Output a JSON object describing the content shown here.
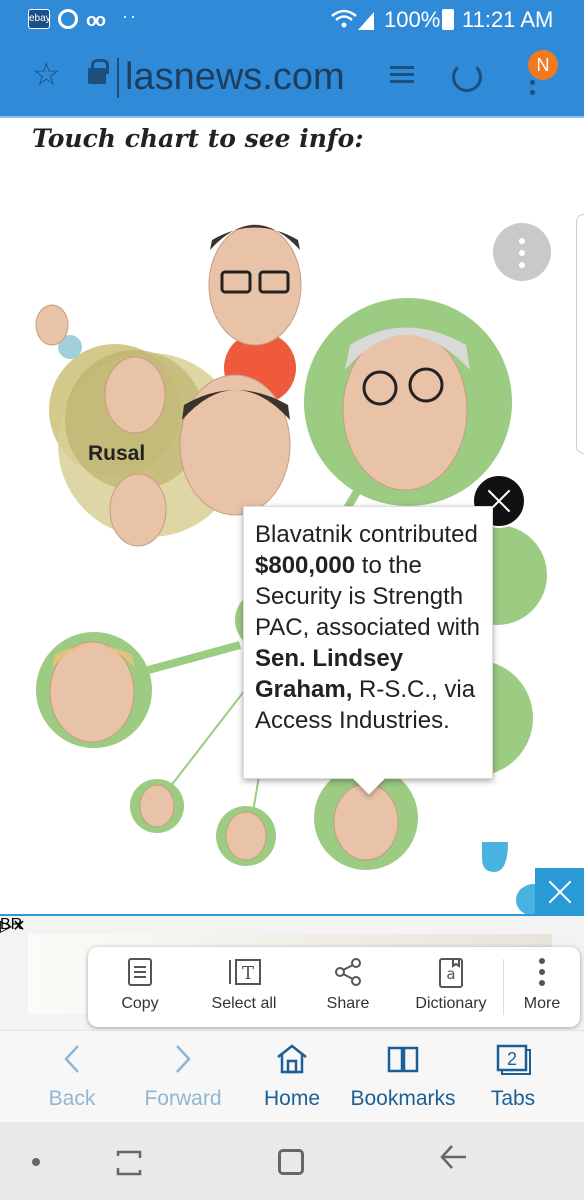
{
  "status_bar": {
    "battery": "100%",
    "time": "11:21 AM",
    "ebay_label": "ebay"
  },
  "browser": {
    "url": "lasnews.com",
    "notification_badge": "N"
  },
  "article": {
    "headline": "Touch chart to see info:",
    "cluster_label": "Rusal",
    "tooltip": {
      "pre": "Blavatnik contributed ",
      "amount": "$800,000",
      "mid": " to the Security is Strength PAC, associated with ",
      "person": "Sen. Lindsey Graham,",
      "post": " R-S.C., via Access Industries."
    }
  },
  "ad": {
    "brand": "BR"
  },
  "context_menu": {
    "items": [
      {
        "label": "Copy",
        "icon": "copy-icon"
      },
      {
        "label": "Select all",
        "icon": "select-all-icon"
      },
      {
        "label": "Share",
        "icon": "share-icon"
      },
      {
        "label": "Dictionary",
        "icon": "dictionary-icon"
      },
      {
        "label": "More",
        "icon": "more-icon"
      }
    ]
  },
  "bottom_nav": {
    "back": "Back",
    "forward": "Forward",
    "home": "Home",
    "bookmarks": "Bookmarks",
    "tabs": "Tabs",
    "tab_count": "2"
  },
  "colors": {
    "brand_blue": "#2f8bd8",
    "node_green": "#9ccb82",
    "node_olive": "#c7be7a",
    "node_red": "#ef5a3c",
    "accent_blue": "#2a9ad6"
  }
}
